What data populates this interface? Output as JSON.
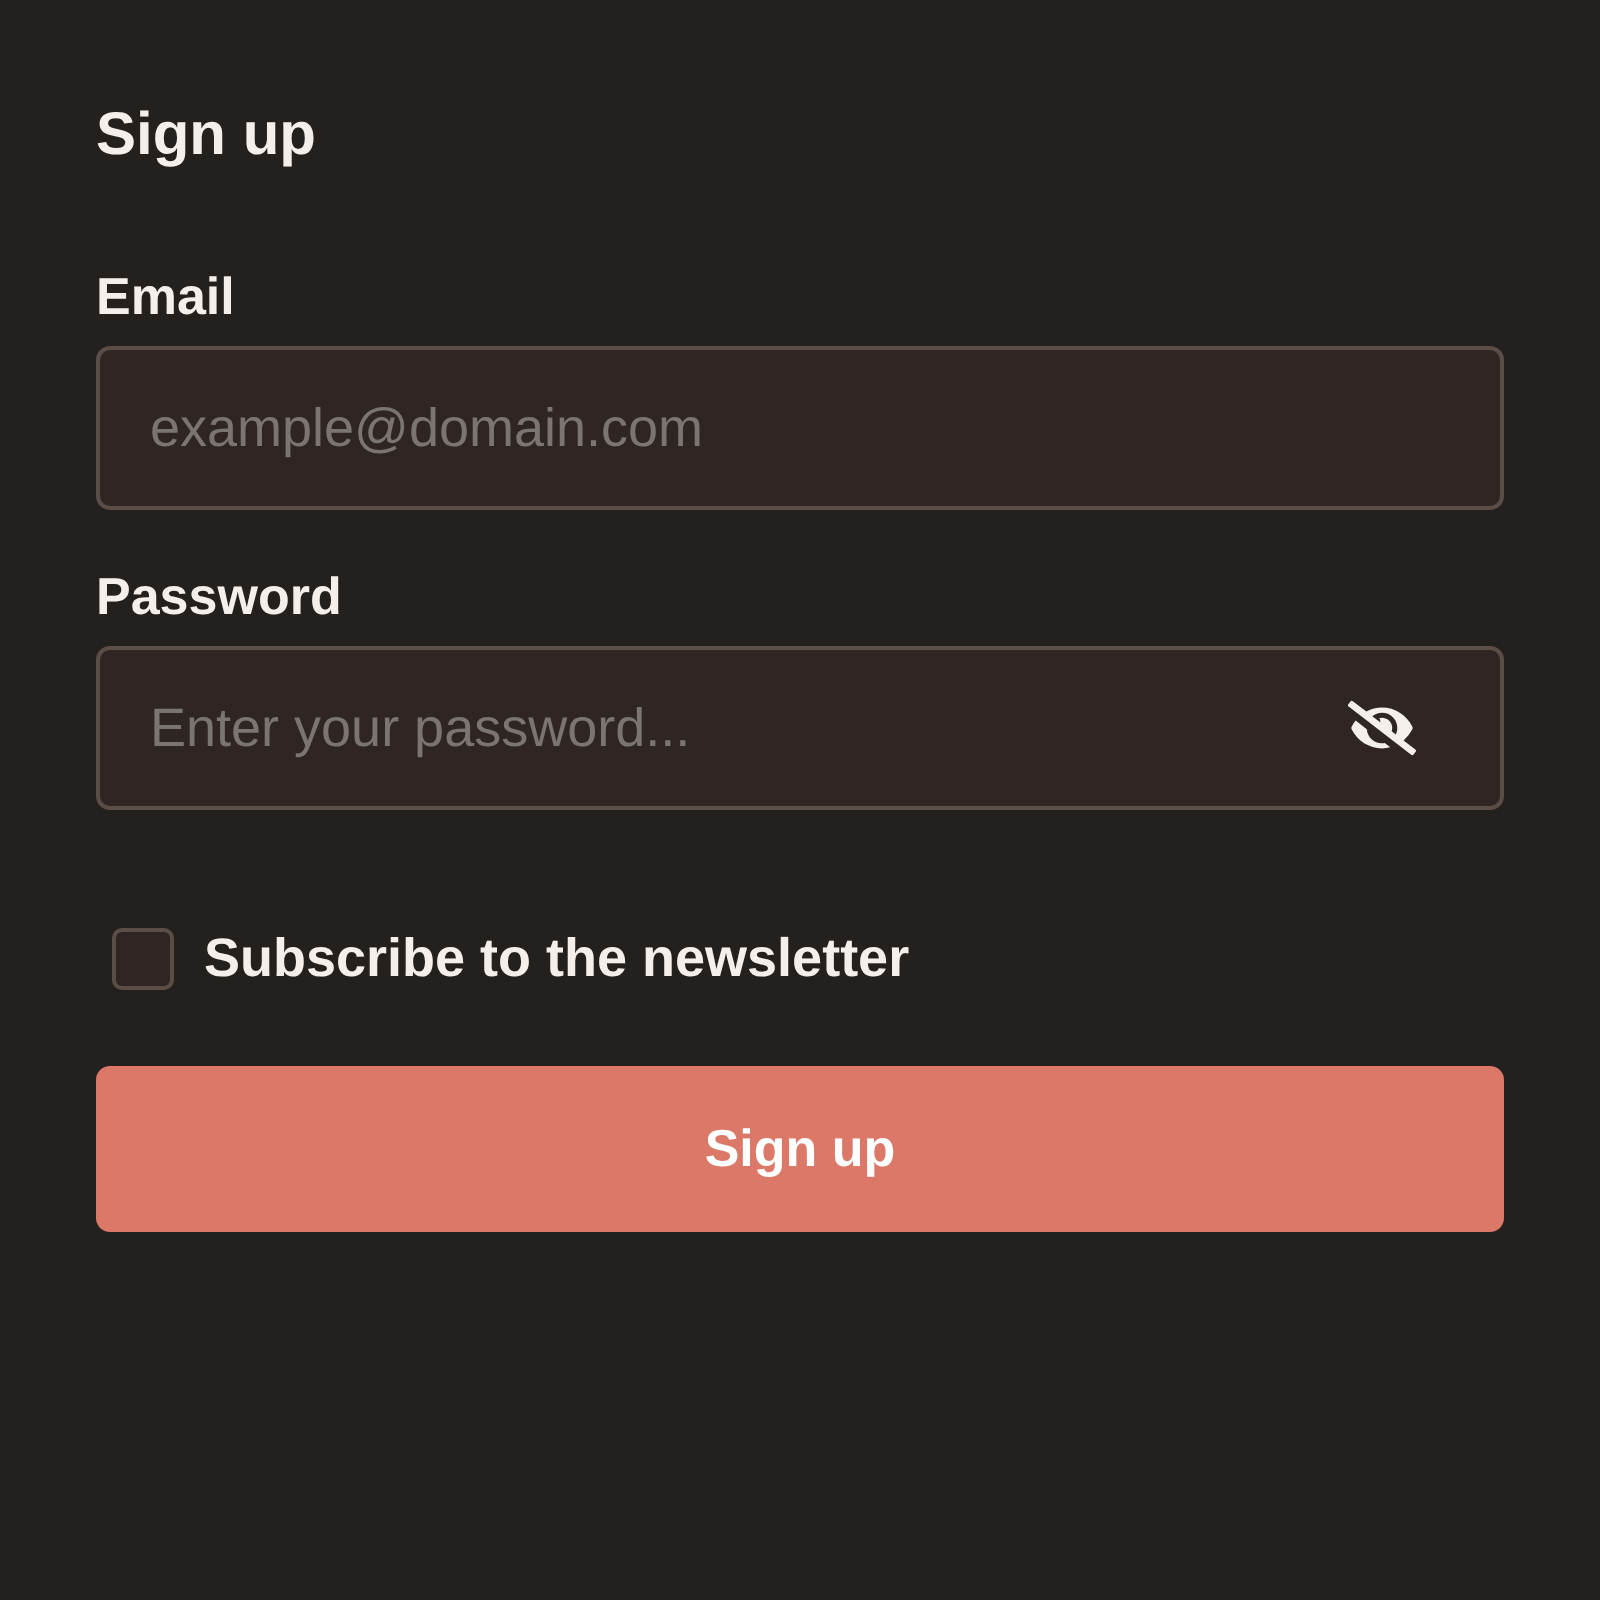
{
  "title": "Sign up",
  "fields": [
    {
      "kind": "email",
      "label": "Email",
      "placeholder": "example@domain.com"
    },
    {
      "kind": "password",
      "label": "Password",
      "placeholder": "Enter your password...",
      "revealed": false
    }
  ],
  "checkbox": {
    "label": "Subscribe to the newsletter",
    "checked": false
  },
  "button": {
    "label": "Sign up"
  }
}
